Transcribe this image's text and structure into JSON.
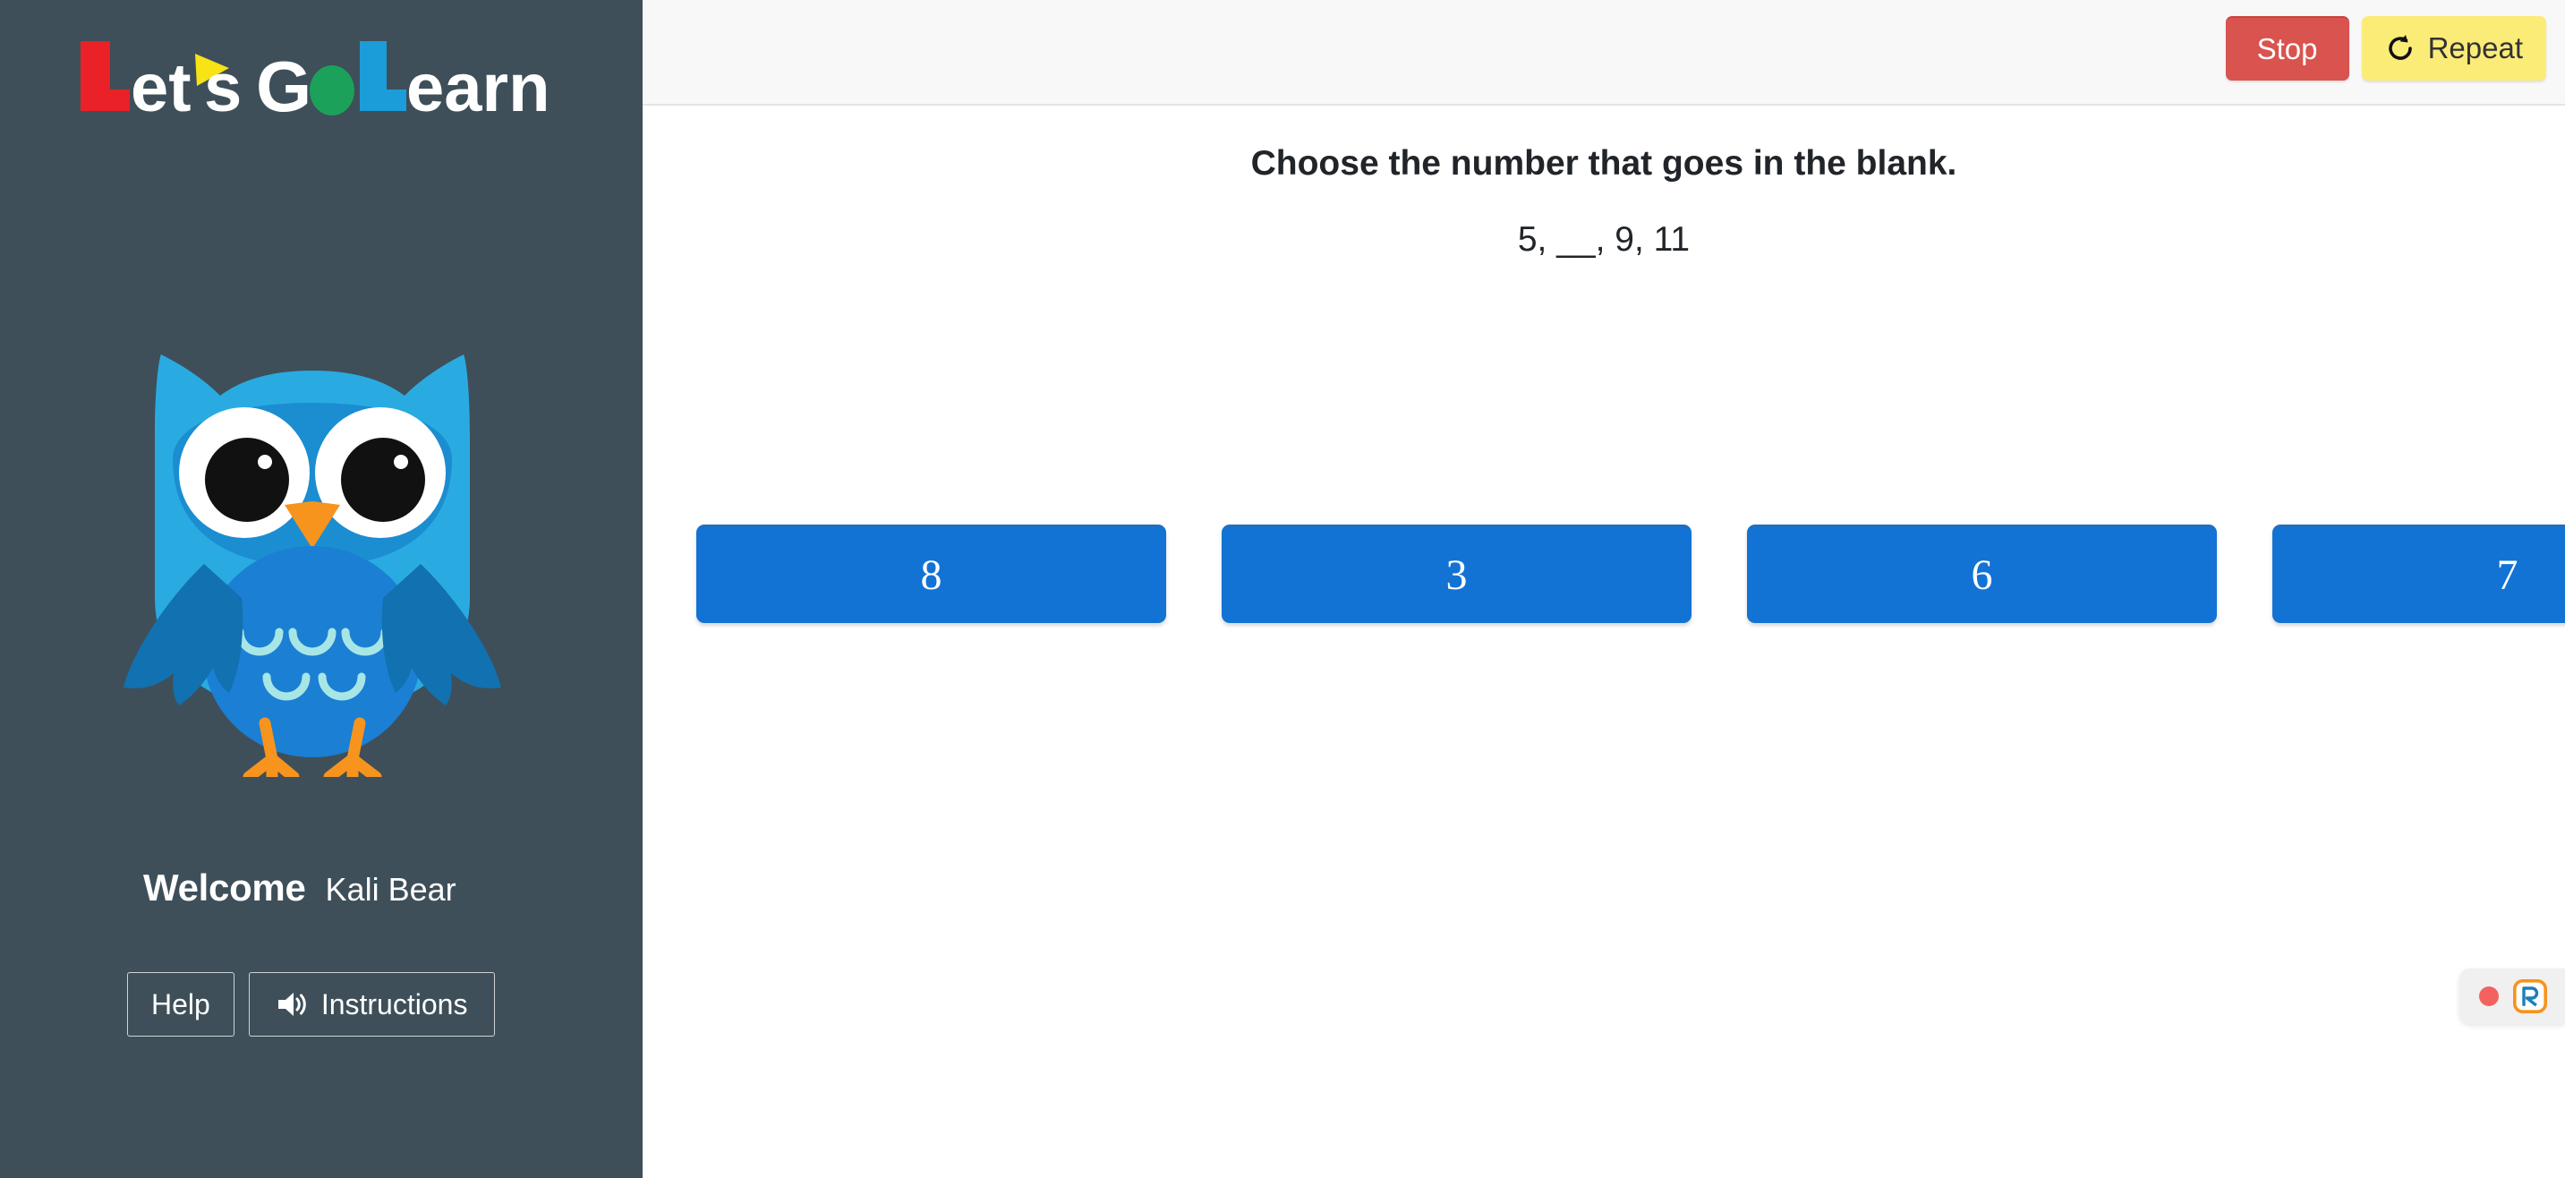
{
  "brand": {
    "logo_text": "Let's Go Learn",
    "logo_parts": [
      "L",
      "et",
      "'",
      "s",
      "G",
      "o",
      "L",
      "earn"
    ],
    "colors": {
      "l_red": "#ea2127",
      "apostrophe_yellow": "#f7e316",
      "o_green": "#1ba159",
      "l_blue": "#1b9dd9",
      "text_white": "#ffffff",
      "sidebar_bg": "#3e4f59"
    }
  },
  "sidebar": {
    "mascot": {
      "name": "owl-mascot",
      "colors": {
        "body": "#29abe2",
        "face": "#1b8dd1",
        "belly": "#1b7fd4",
        "wing": "#1271b0",
        "beak": "#f7941e",
        "feet": "#f7941e",
        "eye_white": "#ffffff",
        "pupil": "#111111",
        "feather": "#a8e6e6"
      }
    },
    "welcome_label": "Welcome",
    "student_name": "Kali Bear",
    "help_label": "Help",
    "instructions_label": "Instructions",
    "instructions_icon": "speaker-icon"
  },
  "toolbar": {
    "stop_label": "Stop",
    "repeat_label": "Repeat",
    "repeat_icon": "refresh-icon",
    "stop_color": "#d9534f",
    "repeat_color": "#fbec78"
  },
  "question": {
    "prompt": "Choose the number that goes in the blank.",
    "sequence": "5, __, 9, 11",
    "choices": [
      {
        "label": "8"
      },
      {
        "label": "3"
      },
      {
        "label": "6"
      },
      {
        "label": "7"
      }
    ],
    "choice_color": "#1273d4"
  },
  "recorder": {
    "name": "recorder-widget",
    "dot_color": "#f4625f",
    "logo_letter": "R",
    "logo_border_color": "#f7931e",
    "logo_letter_color": "#1b7fb8"
  }
}
